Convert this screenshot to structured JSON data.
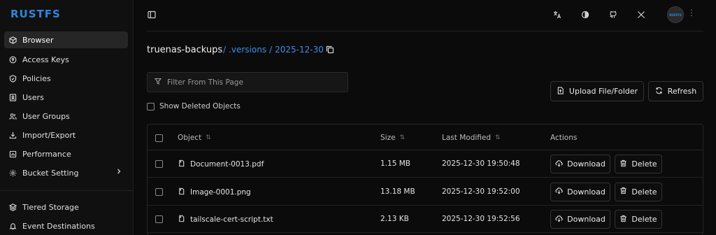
{
  "app": {
    "logo": "RUSTFS",
    "avatar_text": "RUSTFS"
  },
  "sidebar": {
    "items": [
      {
        "label": "Browser",
        "icon": "package-icon",
        "active": true
      },
      {
        "label": "Access Keys",
        "icon": "key-circle-icon"
      },
      {
        "label": "Policies",
        "icon": "shield-icon"
      },
      {
        "label": "Users",
        "icon": "user-card-icon"
      },
      {
        "label": "User Groups",
        "icon": "users-icon"
      },
      {
        "label": "Import/Export",
        "icon": "download-icon"
      },
      {
        "label": "Performance",
        "icon": "chart-icon"
      },
      {
        "label": "Bucket Setting",
        "icon": "gear-icon"
      }
    ],
    "items2": [
      {
        "label": "Tiered Storage",
        "icon": "layers-icon"
      },
      {
        "label": "Event Destinations",
        "icon": "bell-icon"
      }
    ]
  },
  "header": {
    "bucket": "truenas-backups",
    "crumbs": [
      "/",
      ".versions",
      "/",
      "2025-12-30"
    ]
  },
  "filter": {
    "placeholder": "Filter From This Page",
    "value": ""
  },
  "show_deleted": {
    "label": "Show Deleted Objects",
    "checked": false
  },
  "toolbar": {
    "upload_label": "Upload File/Folder",
    "refresh_label": "Refresh"
  },
  "table": {
    "headers": {
      "object": "Object",
      "size": "Size",
      "modified": "Last Modified",
      "actions": "Actions"
    },
    "rows": [
      {
        "name": "Document-0013.pdf",
        "size": "1.15 MB",
        "modified": "2025-12-30 19:50:48"
      },
      {
        "name": "Image-0001.png",
        "size": "13.18 MB",
        "modified": "2025-12-30 19:52:00"
      },
      {
        "name": "tailscale-cert-script.txt",
        "size": "2.13 KB",
        "modified": "2025-12-30 19:52:56"
      }
    ],
    "download_label": "Download",
    "delete_label": "Delete"
  },
  "colors": {
    "accent": "#2f86de",
    "background": "#0b0b0b",
    "sidebar": "#101010"
  }
}
